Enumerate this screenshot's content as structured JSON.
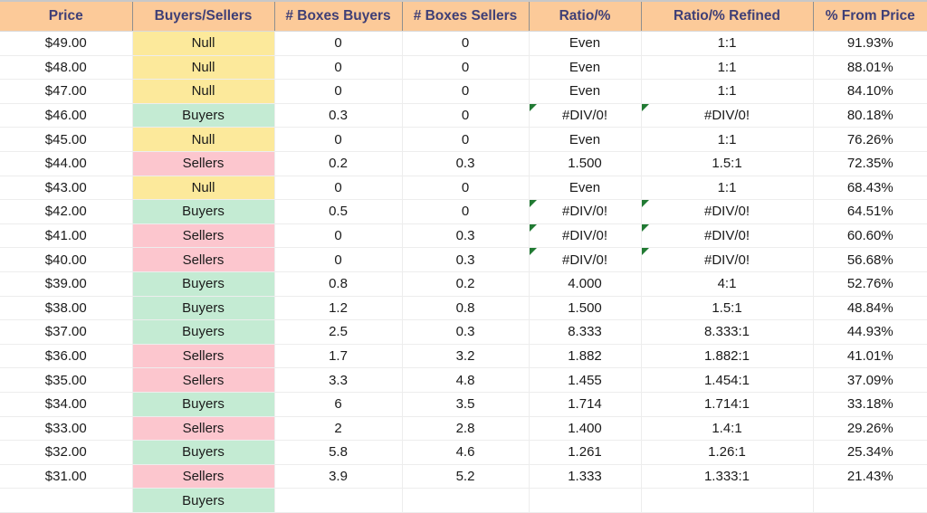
{
  "table": {
    "columns": [
      {
        "key": "price",
        "label": "Price"
      },
      {
        "key": "bs",
        "label": "Buyers/Sellers"
      },
      {
        "key": "bb",
        "label": "# Boxes Buyers"
      },
      {
        "key": "bsel",
        "label": "# Boxes Sellers"
      },
      {
        "key": "ratio",
        "label": "Ratio/%"
      },
      {
        "key": "refined",
        "label": "Ratio/% Refined"
      },
      {
        "key": "pct",
        "label": "% From Price"
      }
    ],
    "rows": [
      {
        "price": "$49.00",
        "bs": "Null",
        "bb": "0",
        "bsel": "0",
        "ratio": "Even",
        "refined": "1:1",
        "pct": "91.93%",
        "error": false
      },
      {
        "price": "$48.00",
        "bs": "Null",
        "bb": "0",
        "bsel": "0",
        "ratio": "Even",
        "refined": "1:1",
        "pct": "88.01%",
        "error": false
      },
      {
        "price": "$47.00",
        "bs": "Null",
        "bb": "0",
        "bsel": "0",
        "ratio": "Even",
        "refined": "1:1",
        "pct": "84.10%",
        "error": false
      },
      {
        "price": "$46.00",
        "bs": "Buyers",
        "bb": "0.3",
        "bsel": "0",
        "ratio": "#DIV/0!",
        "refined": "#DIV/0!",
        "pct": "80.18%",
        "error": true
      },
      {
        "price": "$45.00",
        "bs": "Null",
        "bb": "0",
        "bsel": "0",
        "ratio": "Even",
        "refined": "1:1",
        "pct": "76.26%",
        "error": false
      },
      {
        "price": "$44.00",
        "bs": "Sellers",
        "bb": "0.2",
        "bsel": "0.3",
        "ratio": "1.500",
        "refined": "1.5:1",
        "pct": "72.35%",
        "error": false
      },
      {
        "price": "$43.00",
        "bs": "Null",
        "bb": "0",
        "bsel": "0",
        "ratio": "Even",
        "refined": "1:1",
        "pct": "68.43%",
        "error": false
      },
      {
        "price": "$42.00",
        "bs": "Buyers",
        "bb": "0.5",
        "bsel": "0",
        "ratio": "#DIV/0!",
        "refined": "#DIV/0!",
        "pct": "64.51%",
        "error": true
      },
      {
        "price": "$41.00",
        "bs": "Sellers",
        "bb": "0",
        "bsel": "0.3",
        "ratio": "#DIV/0!",
        "refined": "#DIV/0!",
        "pct": "60.60%",
        "error": true
      },
      {
        "price": "$40.00",
        "bs": "Sellers",
        "bb": "0",
        "bsel": "0.3",
        "ratio": "#DIV/0!",
        "refined": "#DIV/0!",
        "pct": "56.68%",
        "error": true
      },
      {
        "price": "$39.00",
        "bs": "Buyers",
        "bb": "0.8",
        "bsel": "0.2",
        "ratio": "4.000",
        "refined": "4:1",
        "pct": "52.76%",
        "error": false
      },
      {
        "price": "$38.00",
        "bs": "Buyers",
        "bb": "1.2",
        "bsel": "0.8",
        "ratio": "1.500",
        "refined": "1.5:1",
        "pct": "48.84%",
        "error": false
      },
      {
        "price": "$37.00",
        "bs": "Buyers",
        "bb": "2.5",
        "bsel": "0.3",
        "ratio": "8.333",
        "refined": "8.333:1",
        "pct": "44.93%",
        "error": false
      },
      {
        "price": "$36.00",
        "bs": "Sellers",
        "bb": "1.7",
        "bsel": "3.2",
        "ratio": "1.882",
        "refined": "1.882:1",
        "pct": "41.01%",
        "error": false
      },
      {
        "price": "$35.00",
        "bs": "Sellers",
        "bb": "3.3",
        "bsel": "4.8",
        "ratio": "1.455",
        "refined": "1.454:1",
        "pct": "37.09%",
        "error": false
      },
      {
        "price": "$34.00",
        "bs": "Buyers",
        "bb": "6",
        "bsel": "3.5",
        "ratio": "1.714",
        "refined": "1.714:1",
        "pct": "33.18%",
        "error": false
      },
      {
        "price": "$33.00",
        "bs": "Sellers",
        "bb": "2",
        "bsel": "2.8",
        "ratio": "1.400",
        "refined": "1.4:1",
        "pct": "29.26%",
        "error": false
      },
      {
        "price": "$32.00",
        "bs": "Buyers",
        "bb": "5.8",
        "bsel": "4.6",
        "ratio": "1.261",
        "refined": "1.26:1",
        "pct": "25.34%",
        "error": false
      },
      {
        "price": "$31.00",
        "bs": "Sellers",
        "bb": "3.9",
        "bsel": "5.2",
        "ratio": "1.333",
        "refined": "1.333:1",
        "pct": "21.43%",
        "error": false
      },
      {
        "price": "",
        "bs": "Buyers",
        "bb": "",
        "bsel": "",
        "ratio": "",
        "refined": "",
        "pct": "",
        "error": false
      }
    ]
  },
  "colors": {
    "header_background": "#fcca99",
    "header_text": "#3f3f76",
    "null_background": "#fce99b",
    "null_text": "#b0761b",
    "buyers_background": "#c4ebd3",
    "buyers_text": "#1a7a35",
    "sellers_background": "#fcc6ce",
    "sellers_text": "#b01630",
    "error_flag": "#217a33"
  }
}
